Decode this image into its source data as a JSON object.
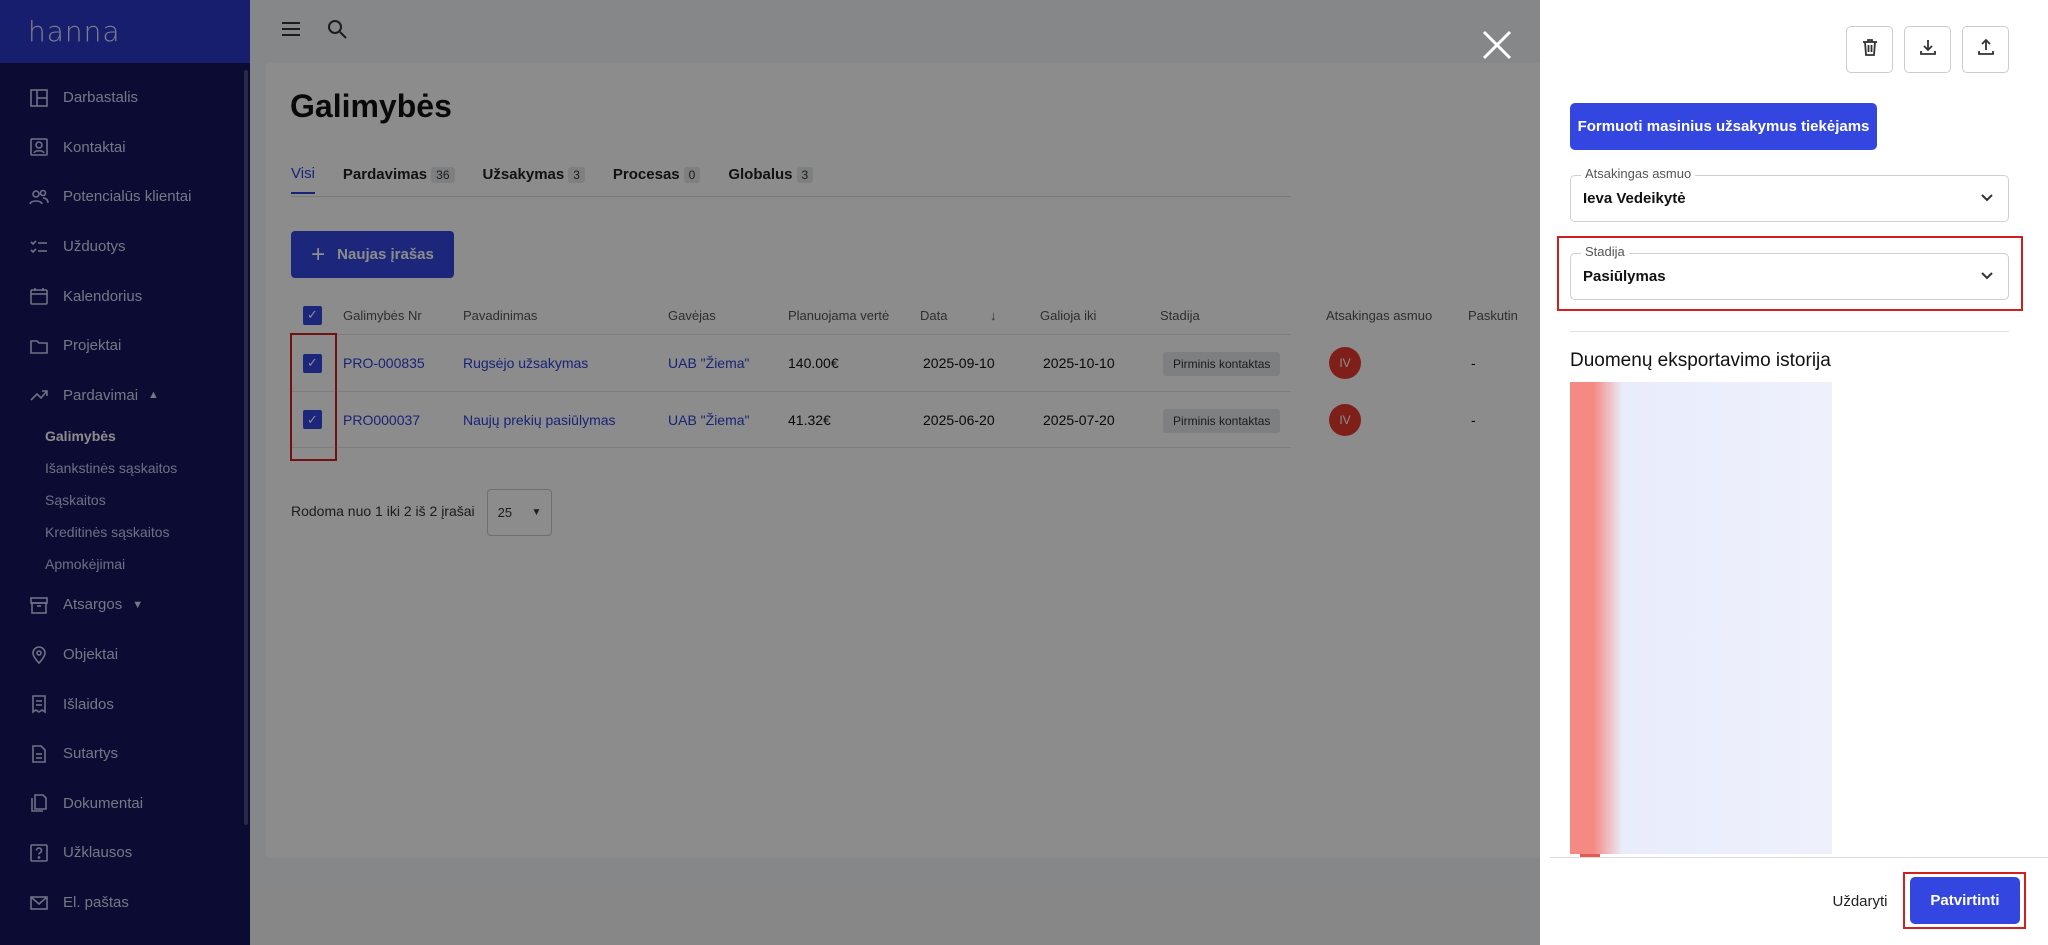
{
  "app": {
    "logo": "hanna"
  },
  "sidebar": {
    "items": [
      {
        "label": "Darbastalis",
        "icon": "dashboard-icon"
      },
      {
        "label": "Kontaktai",
        "icon": "contact-card-icon"
      },
      {
        "label": "Potencialūs klientai",
        "icon": "people-icon"
      },
      {
        "label": "Užduotys",
        "icon": "checklist-icon"
      },
      {
        "label": "Kalendorius",
        "icon": "calendar-icon"
      },
      {
        "label": "Projektai",
        "icon": "folder-icon"
      },
      {
        "label": "Pardavimai",
        "icon": "trend-icon"
      }
    ],
    "sub_items": [
      "Galimybės",
      "Išankstinės sąskaitos",
      "Sąskaitos",
      "Kreditinės sąskaitos",
      "Apmokėjimai"
    ],
    "items_after": [
      {
        "label": "Atsargos",
        "icon": "box-icon"
      },
      {
        "label": "Objektai",
        "icon": "location-icon"
      },
      {
        "label": "Išlaidos",
        "icon": "receipt-icon"
      },
      {
        "label": "Sutartys",
        "icon": "document-icon"
      },
      {
        "label": "Dokumentai",
        "icon": "documents-icon"
      },
      {
        "label": "Užklausos",
        "icon": "question-icon"
      },
      {
        "label": "El. paštas",
        "icon": "mail-icon"
      }
    ]
  },
  "page": {
    "title": "Galimybės",
    "tabs": [
      {
        "label": "Visi",
        "count": ""
      },
      {
        "label": "Pardavimas",
        "count": "36"
      },
      {
        "label": "Užsakymas",
        "count": "3"
      },
      {
        "label": "Procesas",
        "count": "0"
      },
      {
        "label": "Globalus",
        "count": "3"
      }
    ],
    "new_button": "Naujas įrašas",
    "table": {
      "headers": [
        "Galimybės Nr",
        "Pavadinimas",
        "Gavėjas",
        "Planuojama vertė",
        "Data",
        "Galioja iki",
        "Stadija",
        "Atsakingas asmuo",
        "Paskutin"
      ],
      "rows": [
        {
          "nr": "PRO-000835",
          "name": "Rugsėjo užsakymas",
          "recipient": "UAB \"Žiema\"",
          "value": "140.00€",
          "date": "2025-09-10",
          "valid": "2025-10-10",
          "stage": "Pirminis kontaktas",
          "avatar": "IV",
          "last": "-"
        },
        {
          "nr": "PRO000037",
          "name": "Naujų prekių pasiūlymas",
          "recipient": "UAB \"Žiema\"",
          "value": "41.32€",
          "date": "2025-06-20",
          "valid": "2025-07-20",
          "stage": "Pirminis kontaktas",
          "avatar": "IV",
          "last": "-"
        }
      ]
    },
    "footer_text": "Rodoma nuo 1 iki 2 iš 2 įrašai",
    "page_size": "25"
  },
  "drawer": {
    "primary_button": "Formuoti masinius užsakymus tiekėjams",
    "responsible_label": "Atsakingas asmuo",
    "responsible_value": "Ieva Vedeikytė",
    "stage_label": "Stadija",
    "stage_value": "Pasiūlymas",
    "section_title": "Duomenų eksportavimo istorija",
    "cancel": "Uždaryti",
    "confirm": "Patvirtinti"
  },
  "colors": {
    "accent": "#3347e0",
    "sidebar": "#16155e",
    "highlight": "#d02020"
  }
}
